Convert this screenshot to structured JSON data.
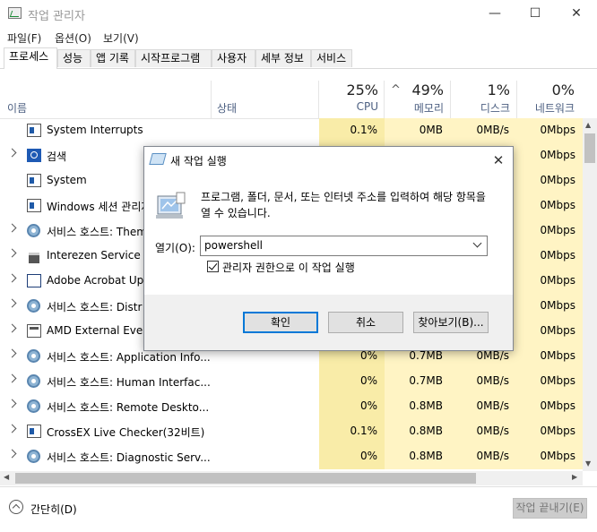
{
  "window": {
    "title": "작업 관리자",
    "minimize": "—",
    "maximize": "☐",
    "close": "✕"
  },
  "menu": [
    "파일(F)",
    "옵션(O)",
    "보기(V)"
  ],
  "tabs": [
    "프로세스",
    "성능",
    "앱 기록",
    "시작프로그램",
    "사용자",
    "세부 정보",
    "서비스"
  ],
  "columns": {
    "name": "이름",
    "status": "상태",
    "cpu": {
      "pct": "25%",
      "label": "CPU"
    },
    "memory": {
      "pct": "49%",
      "label": "메모리",
      "sort_arrow": "^"
    },
    "disk": {
      "pct": "1%",
      "label": "디스크"
    },
    "network": {
      "pct": "0%",
      "label": "네트워크"
    }
  },
  "rows": [
    {
      "name": "System Interrupts",
      "cpu": "0.1%",
      "mem": "0MB",
      "disk": "0MB/s",
      "net": "0Mbps",
      "icon": "system-icon",
      "expand": false
    },
    {
      "name": "검색",
      "cpu": "",
      "mem": "",
      "disk": "",
      "net": "0Mbps",
      "icon": "search-icon",
      "expand": true
    },
    {
      "name": "System",
      "cpu": "",
      "mem": "",
      "disk": "",
      "net": "0Mbps",
      "icon": "system-icon",
      "expand": false
    },
    {
      "name": "Windows 세션 관리자",
      "cpu": "",
      "mem": "",
      "disk": "",
      "net": "0Mbps",
      "icon": "system-icon",
      "expand": false
    },
    {
      "name": "서비스 호스트: Them",
      "cpu": "",
      "mem": "",
      "disk": "",
      "net": "0Mbps",
      "icon": "gear-icon",
      "expand": true
    },
    {
      "name": "Interezen Service Pro",
      "cpu": "",
      "mem": "",
      "disk": "",
      "net": "0Mbps",
      "icon": "interezen-icon",
      "expand": true
    },
    {
      "name": "Adobe Acrobat Upda",
      "cpu": "",
      "mem": "",
      "disk": "",
      "net": "0Mbps",
      "icon": "acrobat-icon",
      "expand": true
    },
    {
      "name": "서비스 호스트: Distr",
      "cpu": "",
      "mem": "",
      "disk": "",
      "net": "0Mbps",
      "icon": "gear-icon",
      "expand": true
    },
    {
      "name": "AMD External Events",
      "cpu": "",
      "mem": "",
      "disk": "",
      "net": "0Mbps",
      "icon": "amd-icon",
      "expand": true
    },
    {
      "name": "서비스 호스트: Application Info...",
      "cpu": "0%",
      "mem": "0.7MB",
      "disk": "0MB/s",
      "net": "0Mbps",
      "icon": "gear-icon",
      "expand": true
    },
    {
      "name": "서비스 호스트: Human Interfac...",
      "cpu": "0%",
      "mem": "0.7MB",
      "disk": "0MB/s",
      "net": "0Mbps",
      "icon": "gear-icon",
      "expand": true
    },
    {
      "name": "서비스 호스트: Remote Deskto...",
      "cpu": "0%",
      "mem": "0.8MB",
      "disk": "0MB/s",
      "net": "0Mbps",
      "icon": "gear-icon",
      "expand": true
    },
    {
      "name": "CrossEX Live Checker(32비트)",
      "cpu": "0.1%",
      "mem": "0.8MB",
      "disk": "0MB/s",
      "net": "0Mbps",
      "icon": "crossex-icon",
      "expand": true
    },
    {
      "name": "서비스 호스트: Diagnostic Serv...",
      "cpu": "0%",
      "mem": "0.8MB",
      "disk": "0MB/s",
      "net": "0Mbps",
      "icon": "gear-icon",
      "expand": true
    }
  ],
  "footer": {
    "collapse_label": "간단히(D)",
    "end_task_label": "작업 끝내기(E)"
  },
  "dialog": {
    "title": "새 작업 실행",
    "close": "✕",
    "prompt": "프로그램, 폴더, 문서, 또는 인터넷 주소를 입력하여 해당 항목을 열 수 있습니다.",
    "open_label": "열기(O):",
    "open_value": "powershell",
    "admin_label": "관리자 권한으로 이 작업 실행",
    "admin_checked": true,
    "ok_label": "확인",
    "cancel_label": "취소",
    "browse_label": "찾아보기(B)..."
  },
  "colors": {
    "heat_light": "#fff4c4",
    "heat_mid": "#f9eca8",
    "accent": "#0078d7"
  }
}
